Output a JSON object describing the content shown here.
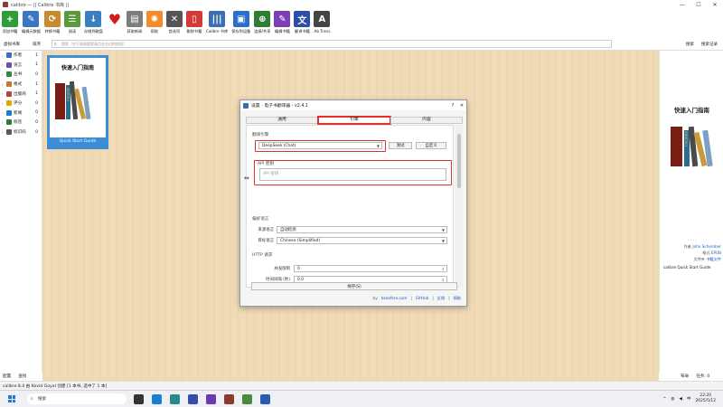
{
  "window": {
    "title": "calibre — || Calibre 书库 ||",
    "controls": [
      "—",
      "☐",
      "✕"
    ]
  },
  "toolbar": [
    {
      "label": "添加书籍",
      "icon": "add-book-icon",
      "color": "#2e9d3a",
      "glyph": "+"
    },
    {
      "label": "编辑元数据",
      "icon": "edit-metadata-icon",
      "color": "#3a76c2",
      "glyph": "✎"
    },
    {
      "label": "转换书籍",
      "icon": "convert-books-icon",
      "color": "#c58b2f",
      "glyph": "⟳"
    },
    {
      "label": "阅读",
      "icon": "read-book-icon",
      "color": "#5a9a3a",
      "glyph": "☰"
    },
    {
      "label": "存储到磁盘",
      "icon": "save-disk-icon",
      "color": "#3a7fc2",
      "glyph": "↓"
    },
    {
      "label": "",
      "icon": "heart-icon",
      "color": "#d11a1a",
      "glyph": "♥"
    },
    {
      "label": "获取新闻",
      "icon": "fetch-news-icon",
      "color": "#7d7d7d",
      "glyph": "▤"
    },
    {
      "label": "帮助",
      "icon": "help-icon",
      "color": "#f08c2a",
      "glyph": "✺"
    },
    {
      "label": "首选项",
      "icon": "preferences-icon",
      "color": "#555555",
      "glyph": "✕"
    },
    {
      "label": "删除书籍",
      "icon": "remove-books-icon",
      "color": "#d43a3a",
      "glyph": "▯"
    },
    {
      "label": "Calibre 书库",
      "icon": "library-icon",
      "color": "#3c6fb3",
      "glyph": "|||"
    },
    {
      "label": "保存到设备",
      "icon": "send-device-icon",
      "color": "#2a6fc9",
      "glyph": "▣"
    },
    {
      "label": "连接/共享",
      "icon": "connect-share-icon",
      "color": "#2e7d32",
      "glyph": "⊕"
    },
    {
      "label": "编辑书籍",
      "icon": "edit-book-icon",
      "color": "#7b3fb3",
      "glyph": "✎"
    },
    {
      "label": "翻译书籍",
      "icon": "translate-book-icon",
      "color": "#2b4fa8",
      "glyph": "文"
    },
    {
      "label": "Ab Trans",
      "icon": "ab-trans-icon",
      "color": "#444444",
      "glyph": "A"
    }
  ],
  "searchbar": {
    "library_label": "虚拟书库",
    "sort_label": "排序",
    "placeholder": "搜索（对于高级搜索请点击左边的按钮）",
    "search_btn": "搜索",
    "saved_search": "搜索记录"
  },
  "sidebar": {
    "items": [
      {
        "label": "作者",
        "count": "1",
        "color": "#3a6fc4"
      },
      {
        "label": "语言",
        "count": "1",
        "color": "#6a4fb0"
      },
      {
        "label": "丛书",
        "count": "0",
        "color": "#2b8a3e"
      },
      {
        "label": "格式",
        "count": "1",
        "color": "#c47a2a"
      },
      {
        "label": "出版商",
        "count": "1",
        "color": "#b0463a"
      },
      {
        "label": "评分",
        "count": "0",
        "color": "#e0a800"
      },
      {
        "label": "新闻",
        "count": "0",
        "color": "#1a7fc7"
      },
      {
        "label": "标签",
        "count": "0",
        "color": "#2e7d32"
      },
      {
        "label": "标识码",
        "count": "0",
        "color": "#5a5a5a"
      }
    ]
  },
  "book": {
    "cover_title": "快速入门指南",
    "caption": "Quick Start Guide",
    "spine_text": "CALIBRE"
  },
  "details": {
    "cover_title": "快速入门指南",
    "dots": "· · · ·",
    "author_key": "作者",
    "author_val": "John Schember",
    "format_key": "格式",
    "format_val": "EPUB",
    "path_key": "文件夹",
    "path_val": "书籍文件",
    "book_title": "calibre Quick Start Guide"
  },
  "bottom": {
    "configure": "配置",
    "find": "查找",
    "layout": "布局",
    "jobs": "任务: 0"
  },
  "statusbar": {
    "text": "calibre 8.4 由 Kovid Goyal 创建    [1 本书, 选中了 1 本]"
  },
  "taskbar": {
    "search": "搜索",
    "time": "22:20",
    "date": "2025/5/12",
    "lang": "中"
  },
  "dialog": {
    "title": "设置 - 电子书翻译器 - v2.4.1",
    "tabs": [
      "通用",
      "引擎",
      "内容"
    ],
    "active_tab": 1,
    "engine_section": "翻译引擎",
    "engine_value": "DeepSeek (Chat)",
    "test_btn": "测试",
    "custom_btn": "自定义",
    "apikey_section": "API 密钥",
    "apikey_placeholder": "API 密钥",
    "lang_section": "偏好语言",
    "source_lang_label": "来源语言",
    "source_lang_value": "自动检测",
    "target_lang_label": "目标语言",
    "target_lang_value": "Chinese (Simplified)",
    "http_section": "HTTP 请求",
    "concurrency_label": "并发限制",
    "concurrency_value": "0",
    "interval_label": "时间间隔 (秒)",
    "interval_value": "0.0",
    "save_btn": "保存(S)",
    "footer_by": "by",
    "footer_links": [
      "bookfere.com",
      "GitHub",
      "反馈",
      "捐助"
    ]
  },
  "colors": {
    "accent_red": "#e03131",
    "selection_blue": "#3c8dd8",
    "wood": "#f0dbb6"
  }
}
